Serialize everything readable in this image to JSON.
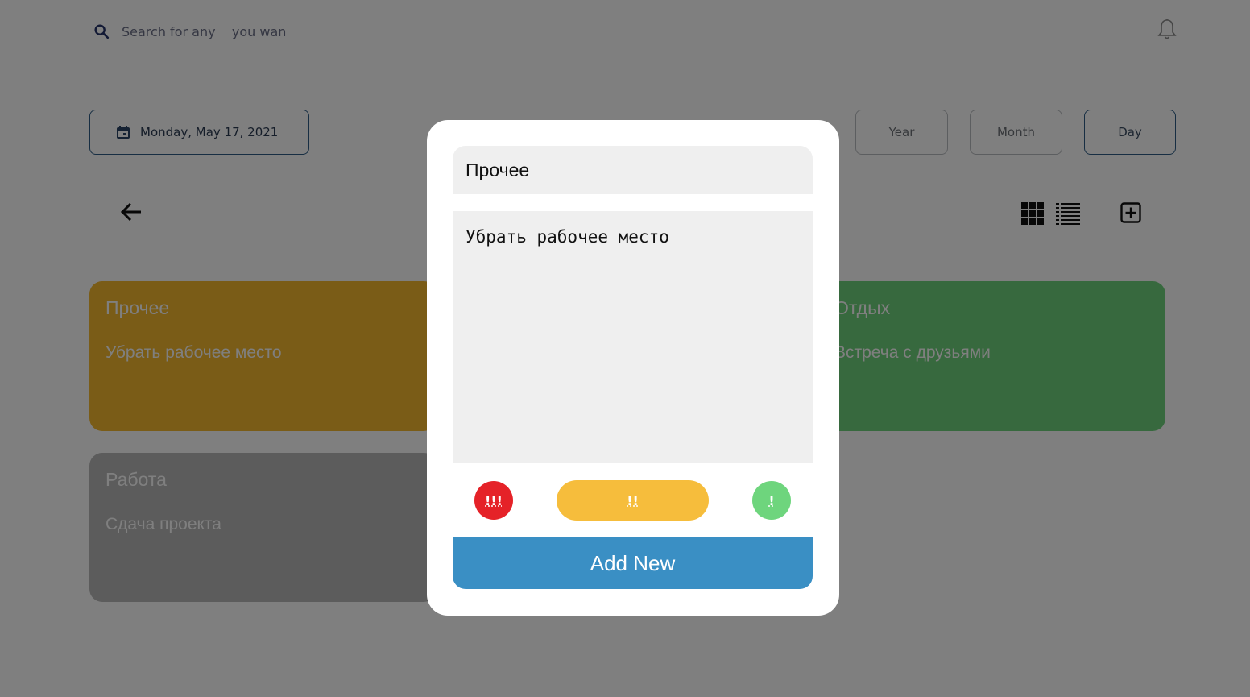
{
  "search": {
    "placeholder": "Search for any    you wan"
  },
  "date": {
    "label": "Monday, May 17, 2021"
  },
  "periods": [
    {
      "label": "Year",
      "active": false
    },
    {
      "label": "Month",
      "active": false
    },
    {
      "label": "Day",
      "active": true
    }
  ],
  "cards": [
    {
      "title": "Прочее",
      "text": "Убрать рабочее место",
      "color": "#f5b82e"
    },
    {
      "title": "Отдых",
      "text": "Встреча с друзьями",
      "color": "#6fd27c"
    },
    {
      "title": "Работа",
      "text": "Сдача проекта",
      "color": "#b9b9b9"
    }
  ],
  "modal": {
    "title_value": "Прочее",
    "text_value": "Убрать рабочее место",
    "priorities": [
      {
        "label": "!!!",
        "color": "#e52228"
      },
      {
        "label": "!!",
        "color": "#f6bd3c"
      },
      {
        "label": "!",
        "color": "#6ed57d"
      }
    ],
    "submit_label": "Add New",
    "submit_color": "#3a8fc4"
  },
  "icons": [
    "search-icon",
    "bell-icon",
    "calendar-icon",
    "back-arrow-icon",
    "grid-view-icon",
    "list-view-icon",
    "add-box-icon"
  ]
}
